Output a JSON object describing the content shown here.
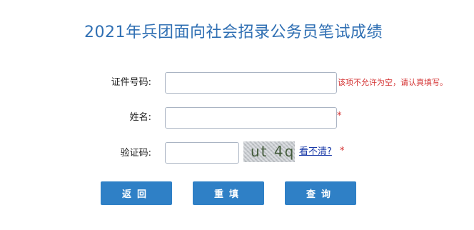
{
  "page_title": "2021年兵团面向社会招录公务员笔试成绩",
  "form": {
    "id_label": "证件号码:",
    "id_value": "",
    "id_error": "该项不允许为空，请认真填写。",
    "name_label": "姓名:",
    "name_value": "",
    "name_star": "*",
    "captcha_label": "验证码:",
    "captcha_value": "",
    "captcha_text": "ut 4q",
    "refresh_link": "看不清?",
    "captcha_star": "*"
  },
  "buttons": {
    "back": "返回",
    "reset": "重填",
    "query": "查询"
  },
  "colors": {
    "title": "#2f6fb3",
    "button": "#2f80c6",
    "error": "#d32f2f",
    "link": "#1a3aa8"
  }
}
